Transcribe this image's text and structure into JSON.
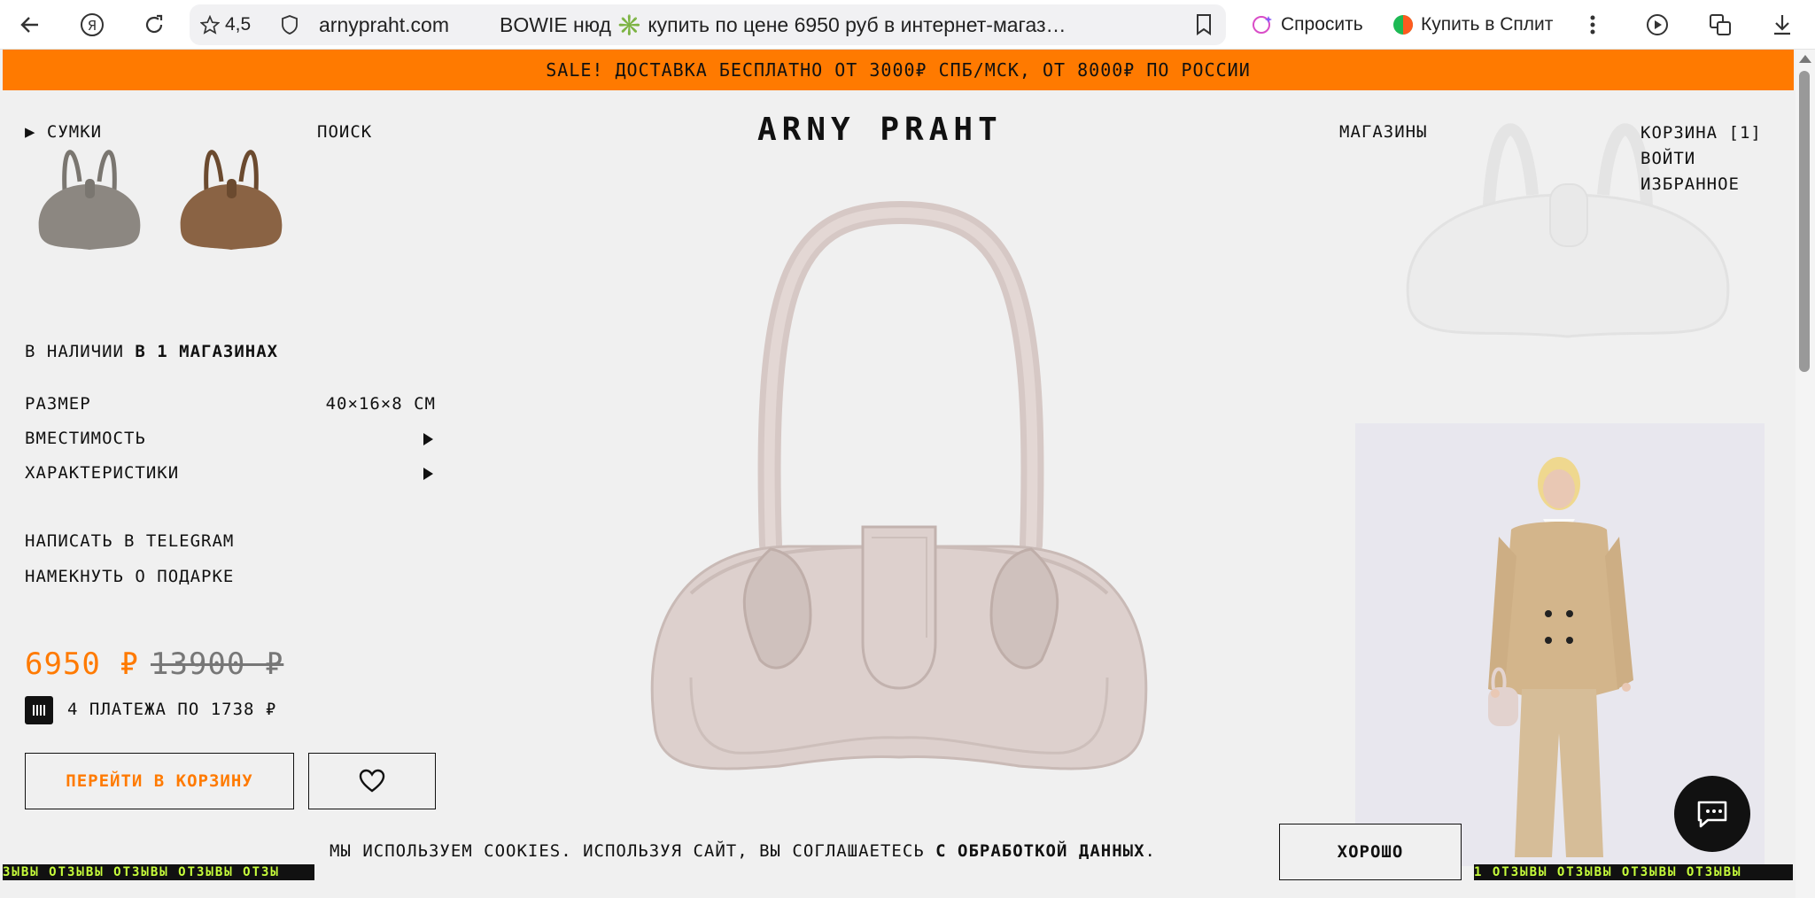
{
  "browser": {
    "rating": "4,5",
    "domain": "arnypraht.com",
    "tab_title": "BOWIE нюд ✳️ купить по цене 6950 руб в интернет-магаз…",
    "ask_label": "Спросить",
    "split_label": "Купить в Сплит"
  },
  "promo": {
    "text": "SALE! ДОСТАВКА БЕСПЛАТНО ОТ 3000₽ СПБ/МСК, ОТ 8000₽ ПО РОССИИ"
  },
  "header": {
    "logo": "ARNY PRAHT",
    "nav_bags": "▶ СУМКИ",
    "nav_search": "ПОИСК",
    "nav_stores": "МАГАЗИНЫ",
    "nav_cart": "КОРЗИНА [1]",
    "nav_login": "ВОЙТИ",
    "nav_favorites": "ИЗБРАННОЕ"
  },
  "product": {
    "availability_prefix": "В НАЛИЧИИ",
    "availability_bold": "В 1 МАГАЗИНАХ",
    "size_label": "РАЗМЕР",
    "size_value": "40×16×8 СМ",
    "capacity_label": "ВМЕСТИМОСТЬ",
    "specs_label": "ХАРАКТЕРИСТИКИ",
    "telegram_link": "НАПИСАТЬ В TELEGRAM",
    "gift_link": "НАМЕКНУТЬ О ПОДАРКЕ",
    "price": "6950 ₽",
    "old_price": "13900 ₽",
    "installments": "4 ПЛАТЕЖА ПО 1738 ₽",
    "cart_button": "ПЕРЕЙТИ В КОРЗИНУ"
  },
  "cookie": {
    "text": "МЫ ИСПОЛЬЗУЕМ COOKIES. ИСПОЛЬЗУЯ САЙТ, ВЫ СОГЛАШАЕТЕСЬ",
    "link": "С ОБРАБОТКОЙ ДАННЫХ",
    "end": ".",
    "ok_button": "ХОРОШО"
  },
  "ticker": {
    "left": "ЗЫВЫ ОТЗЫВЫ ОТЗЫВЫ ОТЗЫВЫ ОТЗЫ",
    "right": "1 ОТЗЫВЫ ОТЗЫВЫ ОТЗЫВЫ ОТЗЫВЫ"
  },
  "colors": {
    "accent": "#ff7a00",
    "bag": "#ddd0cd",
    "ticker_text": "#c8ff3c"
  }
}
